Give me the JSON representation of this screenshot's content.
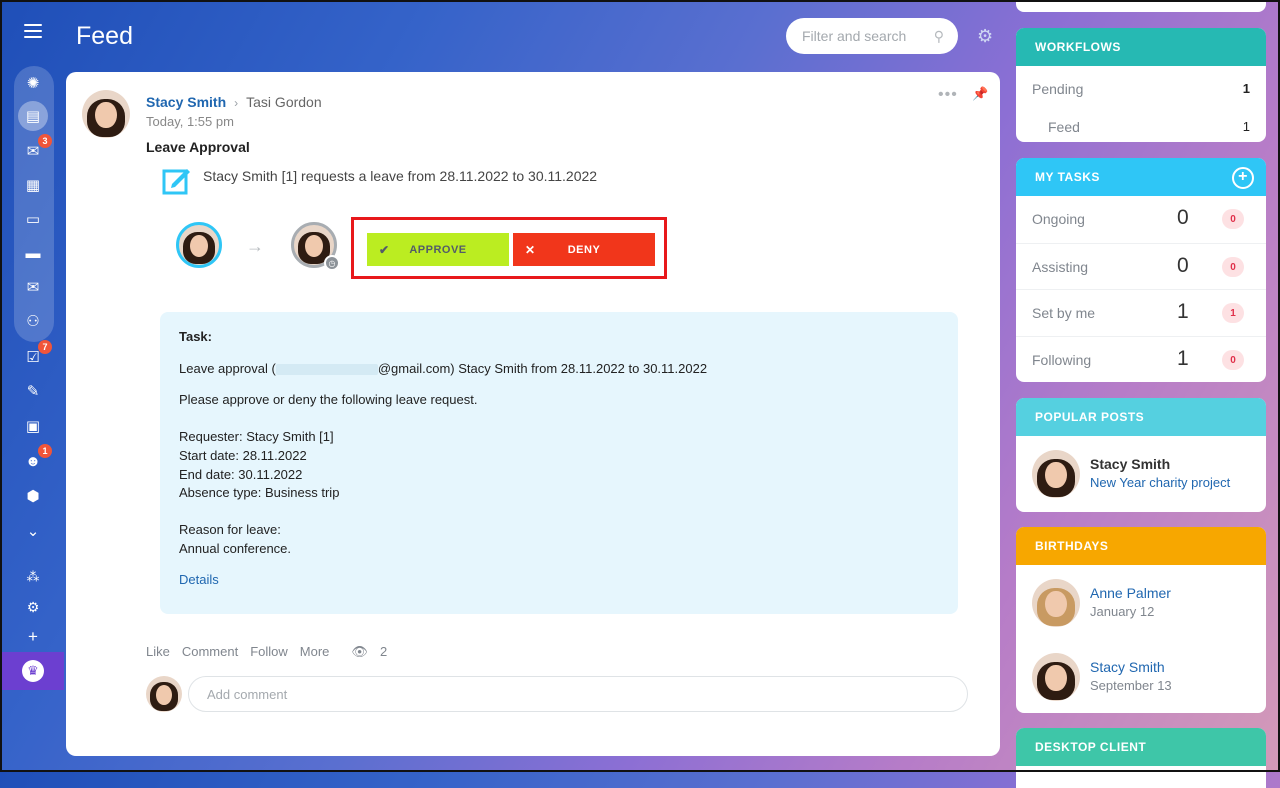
{
  "header": {
    "title": "Feed",
    "search_placeholder": "Filter and search"
  },
  "nav": {
    "badges": {
      "chat": "3",
      "tasks": "7",
      "robot": "1"
    }
  },
  "post": {
    "author": "Stacy Smith",
    "recipient": "Tasi Gordon",
    "time": "Today, 1:55 pm",
    "title": "Leave Approval",
    "workflow_text": "Stacy Smith [1] requests a leave from 28.11.2022 to 30.11.2022",
    "approve_label": "APPROVE",
    "deny_label": "DENY",
    "task": {
      "label": "Task:",
      "line1_prefix": "Leave approval (",
      "line1_suffix": "@gmail.com) Stacy Smith from 28.11.2022 to 30.11.2022",
      "line2": "Please approve or deny the following leave request.",
      "requester": "Requester: Stacy Smith [1]",
      "start": "Start date: 28.11.2022",
      "end": "End date: 30.11.2022",
      "absence": "Absence type: Business trip",
      "reason_label": "Reason for leave:",
      "reason": "Annual conference.",
      "details": "Details"
    },
    "actions": {
      "like": "Like",
      "comment": "Comment",
      "follow": "Follow",
      "more": "More",
      "views": "2"
    },
    "comment_placeholder": "Add comment"
  },
  "workflows": {
    "title": "WORKFLOWS",
    "rows": [
      {
        "label": "Pending",
        "value": "1"
      },
      {
        "label": "Feed",
        "value": "1"
      }
    ]
  },
  "my_tasks": {
    "title": "MY TASKS",
    "rows": [
      {
        "label": "Ongoing",
        "count": "0",
        "badge": "0"
      },
      {
        "label": "Assisting",
        "count": "0",
        "badge": "0"
      },
      {
        "label": "Set by me",
        "count": "1",
        "badge": "1"
      },
      {
        "label": "Following",
        "count": "1",
        "badge": "0"
      }
    ]
  },
  "popular_posts": {
    "title": "POPULAR POSTS",
    "author": "Stacy Smith",
    "post": "New Year charity project"
  },
  "birthdays": {
    "title": "BIRTHDAYS",
    "people": [
      {
        "name": "Anne Palmer",
        "date": "January 12"
      },
      {
        "name": "Stacy Smith",
        "date": "September 13"
      }
    ]
  },
  "desktop_client": {
    "title": "DESKTOP CLIENT"
  },
  "colors": {
    "accent_blue": "#2067b0",
    "approve": "#bbed21",
    "deny": "#f1361b",
    "highlight_border": "#e8181b",
    "workflows_header": "#26b9b3",
    "tasks_header": "#2fc6f6",
    "popular_header": "#55d0e0",
    "birthdays_header": "#f7a700",
    "desktop_header": "#3ec6a8"
  }
}
